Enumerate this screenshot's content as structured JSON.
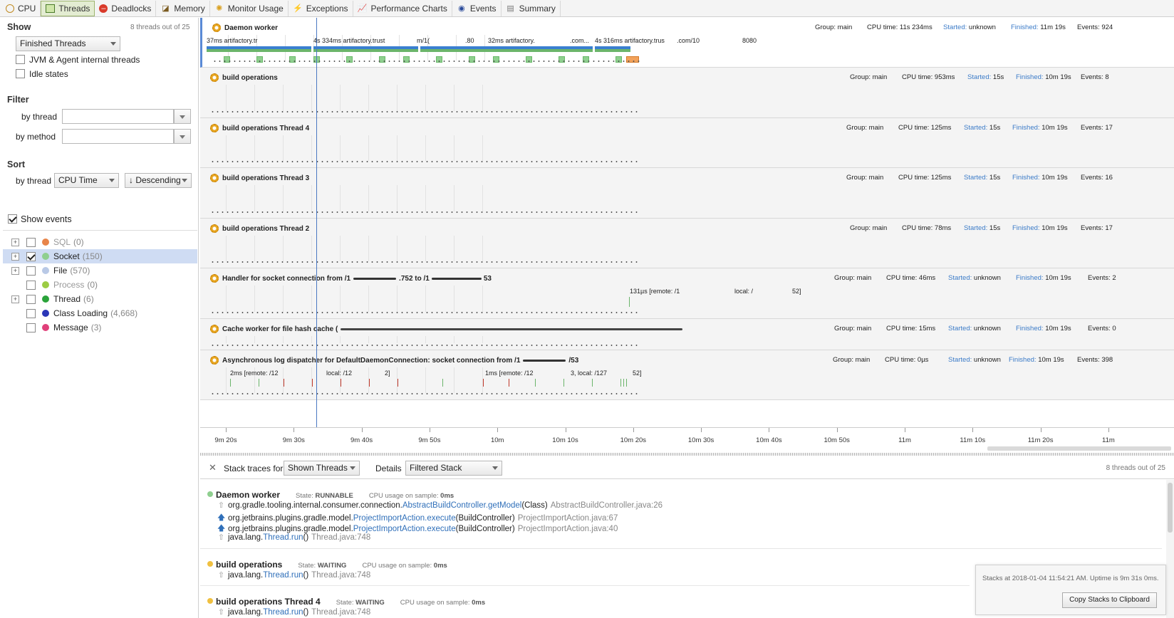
{
  "tabs": [
    {
      "label": "CPU",
      "icon": "cpu-icon"
    },
    {
      "label": "Threads",
      "icon": "threads-icon",
      "active": true
    },
    {
      "label": "Deadlocks",
      "icon": "deadlocks-icon"
    },
    {
      "label": "Memory",
      "icon": "memory-icon"
    },
    {
      "label": "Monitor Usage",
      "icon": "monitor-usage-icon"
    },
    {
      "label": "Exceptions",
      "icon": "exceptions-icon"
    },
    {
      "label": "Performance Charts",
      "icon": "performance-charts-icon"
    },
    {
      "label": "Events",
      "icon": "events-icon"
    },
    {
      "label": "Summary",
      "icon": "summary-icon"
    }
  ],
  "left": {
    "show_title": "Show",
    "threads_count": "8 threads out of 25",
    "show_select": "Finished Threads",
    "jvm_label": "JVM & Agent internal threads",
    "idle_label": "Idle states",
    "filter_title": "Filter",
    "by_thread": "by thread",
    "by_method": "by method",
    "sort_title": "Sort",
    "sort_by_thread": "by thread",
    "sort_field": "CPU Time",
    "sort_order": "↓ Descending",
    "show_events": "Show events",
    "events": [
      {
        "name": "SQL",
        "count": "(0)",
        "color": "#e8854a",
        "expandable": true,
        "checked": false,
        "dim": true
      },
      {
        "name": "Socket",
        "count": "(150)",
        "color": "#8fcf8f",
        "expandable": true,
        "checked": true,
        "selected": true
      },
      {
        "name": "File",
        "count": "(570)",
        "color": "#b9c9e6",
        "expandable": true,
        "checked": false
      },
      {
        "name": "Process",
        "count": "(0)",
        "color": "#9ccc44",
        "expandable": false,
        "checked": false,
        "dim": true
      },
      {
        "name": "Thread",
        "count": "(6)",
        "color": "#2aa33a",
        "expandable": true,
        "checked": false
      },
      {
        "name": "Class Loading",
        "count": "(4,668)",
        "color": "#2a36b8",
        "expandable": false,
        "checked": false
      },
      {
        "name": "Message",
        "count": "(3)",
        "color": "#e0407a",
        "expandable": false,
        "checked": false
      }
    ]
  },
  "threads": [
    {
      "name": "Daemon worker",
      "group": "Group: main",
      "cpu": "CPU time: 11s 234ms",
      "started_k": "Started:",
      "started_v": "unknown",
      "finished_k": "Finished:",
      "finished_v": "11m 19s",
      "events": "Events: 924",
      "annotations": [
        "37ms  artifactory.tr",
        "4s 334ms  artifactory.trust",
        "m/1(",
        ".80",
        "32ms  artifactory.",
        ".com...",
        "4s 316ms  artifactory.trus",
        ".com/10",
        "8080"
      ]
    },
    {
      "name": "build operations",
      "group": "Group: main",
      "cpu": "CPU time: 953ms",
      "started_k": "Started:",
      "started_v": "15s",
      "finished_k": "Finished:",
      "finished_v": "10m 19s",
      "events": "Events: 8"
    },
    {
      "name": "build operations Thread 4",
      "group": "Group: main",
      "cpu": "CPU time: 125ms",
      "started_k": "Started:",
      "started_v": "15s",
      "finished_k": "Finished:",
      "finished_v": "10m 19s",
      "events": "Events: 17"
    },
    {
      "name": "build operations Thread 3",
      "group": "Group: main",
      "cpu": "CPU time: 125ms",
      "started_k": "Started:",
      "started_v": "15s",
      "finished_k": "Finished:",
      "finished_v": "10m 19s",
      "events": "Events: 16"
    },
    {
      "name": "build operations Thread 2",
      "group": "Group: main",
      "cpu": "CPU time: 78ms",
      "started_k": "Started:",
      "started_v": "15s",
      "finished_k": "Finished:",
      "finished_v": "10m 19s",
      "events": "Events: 17"
    },
    {
      "name": "Handler for socket connection from /1",
      "name_tail": ".752 to /1",
      "name_tail2": "53",
      "group": "Group: main",
      "cpu": "CPU time: 46ms",
      "started_k": "Started:",
      "started_v": "unknown",
      "finished_k": "Finished:",
      "finished_v": "10m 19s",
      "events": "Events: 2",
      "annotations": [
        "131µs  [remote: /1",
        "local: /",
        "52]"
      ]
    },
    {
      "name": "Cache worker for file hash cache (",
      "group": "Group: main",
      "cpu": "CPU time: 15ms",
      "started_k": "Started:",
      "started_v": "unknown",
      "finished_k": "Finished:",
      "finished_v": "10m 19s",
      "events": "Events: 0"
    },
    {
      "name": "Asynchronous log dispatcher for DefaultDaemonConnection: socket connection from /1",
      "name_tail": "/53",
      "group": "Group: main",
      "cpu": "CPU time: 0µs",
      "started_k": "Started:",
      "started_v": "unknown",
      "finished_k": "Finished:",
      "finished_v": "10m 19s",
      "events": "Events: 398",
      "annotations": [
        "2ms  [remote: /12",
        "local: /12",
        "2]",
        "1ms  [remote: /12",
        "3, local: /127",
        "52]"
      ]
    }
  ],
  "timeline": [
    "9m 20s",
    "9m 30s",
    "9m 40s",
    "9m 50s",
    "10m",
    "10m 10s",
    "10m 20s",
    "10m 30s",
    "10m 40s",
    "10m 50s",
    "11m",
    "11m 10s",
    "11m 20s",
    "11m"
  ],
  "stackbar": {
    "label": "Stack traces for",
    "shown": "Shown Threads",
    "details": "Details",
    "filtered": "Filtered Stack",
    "count": "8 threads out of 25"
  },
  "stacks": [
    {
      "name": "Daemon worker",
      "dot": "#8fcf8f",
      "state_k": "State:",
      "state_v": "RUNNABLE",
      "cpu_k": "CPU usage on sample:",
      "cpu_v": "0ms",
      "frames": [
        {
          "pkg": "org.gradle.tooling.internal.consumer.connection.",
          "method": "AbstractBuildController.getModel",
          "args": "(Class)",
          "loc": "AbstractBuildController.java:26",
          "style": "light"
        },
        {
          "pkg": "org.jetbrains.plugins.gradle.model.",
          "method": "ProjectImportAction.execute",
          "args": "(BuildController)",
          "loc": "ProjectImportAction.java:67",
          "style": "dark"
        },
        {
          "pkg": "org.jetbrains.plugins.gradle.model.",
          "method": "ProjectImportAction.execute",
          "args": "(BuildController)",
          "loc": "ProjectImportAction.java:40",
          "style": "dark"
        },
        {
          "pkg": "java.lang.",
          "method": "Thread.run",
          "args": "()",
          "loc": "Thread.java:748",
          "style": "light"
        }
      ]
    },
    {
      "name": "build operations",
      "dot": "#f0c040",
      "state_k": "State:",
      "state_v": "WAITING",
      "cpu_k": "CPU usage on sample:",
      "cpu_v": "0ms",
      "frames": [
        {
          "pkg": "java.lang.",
          "method": "Thread.run",
          "args": "()",
          "loc": "Thread.java:748",
          "style": "light"
        }
      ]
    },
    {
      "name": "build operations Thread 4",
      "dot": "#f0c040",
      "state_k": "State:",
      "state_v": "WAITING",
      "cpu_k": "CPU usage on sample:",
      "cpu_v": "0ms",
      "frames": [
        {
          "pkg": "java.lang.",
          "method": "Thread.run",
          "args": "()",
          "loc": "Thread.java:748",
          "style": "light"
        }
      ]
    }
  ],
  "popup": {
    "text": "Stacks at 2018-01-04 11:54:21 AM. Uptime is 9m 31s 0ms.",
    "button": "Copy Stacks to Clipboard"
  }
}
